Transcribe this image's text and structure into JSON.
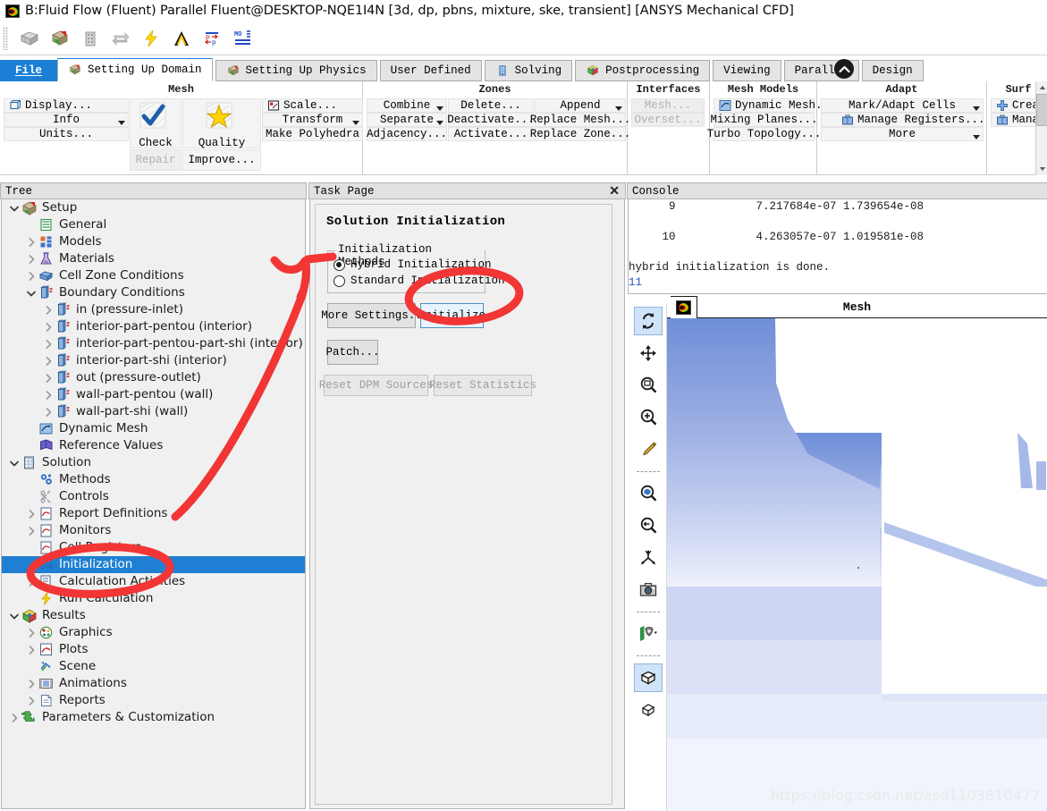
{
  "window": {
    "title": "B:Fluid Flow (Fluent) Parallel Fluent@DESKTOP-NQE1I4N  [3d, dp, pbns, mixture, ske, transient] [ANSYS Mechanical CFD]",
    "app_icon": "fluent-logo-icon"
  },
  "quick_access": [
    {
      "name": "mesh-icon",
      "label": "Mesh"
    },
    {
      "name": "setting-up-domain-icon",
      "label": "Setting Up Domain"
    },
    {
      "name": "solving-icon",
      "label": "Solving"
    },
    {
      "name": "refresh-icon",
      "label": "Refresh"
    },
    {
      "name": "run-calculation-icon",
      "label": "Run Calculation"
    },
    {
      "name": "ansys-icon",
      "label": "ANSYS"
    },
    {
      "name": "p-to-p-icon",
      "label": "Pressure"
    },
    {
      "name": "monitors-icon",
      "label": "Monitors"
    }
  ],
  "tabs": [
    {
      "label": "File",
      "icon": null,
      "state": "file"
    },
    {
      "label": "Setting Up Domain",
      "icon": "domain-icon",
      "state": "active"
    },
    {
      "label": "Setting Up Physics",
      "icon": "physics-icon",
      "state": "normal"
    },
    {
      "label": "User Defined",
      "icon": null,
      "state": "normal"
    },
    {
      "label": "Solving",
      "icon": "solving-icon",
      "state": "normal"
    },
    {
      "label": "Postprocessing",
      "icon": "post-icon",
      "state": "normal"
    },
    {
      "label": "Viewing",
      "icon": null,
      "state": "normal"
    },
    {
      "label": "Parallel",
      "icon": null,
      "state": "normal"
    },
    {
      "label": "Design",
      "icon": null,
      "state": "normal"
    }
  ],
  "ribbon": {
    "collapse_icon": "chevron-up-icon",
    "groups": [
      {
        "title": "Mesh",
        "id": "mesh",
        "col1": [
          {
            "label": "Display...",
            "icon": "display-icon",
            "disabled": false,
            "caret": false
          },
          {
            "label": "Info",
            "icon": null,
            "disabled": false,
            "caret": true
          },
          {
            "label": "Units...",
            "icon": null,
            "disabled": false,
            "caret": false
          }
        ],
        "big1": {
          "label": "Check",
          "icon": "check-icon"
        },
        "big1_sub": {
          "label": "Repair",
          "disabled": true
        },
        "big2": {
          "label": "Quality",
          "icon": "quality-star-icon"
        },
        "big2_sub": {
          "label": "Improve...",
          "disabled": false
        },
        "col4": [
          {
            "label": "Scale...",
            "icon": "scale-icon",
            "disabled": false,
            "caret": false
          },
          {
            "label": "Transform",
            "icon": null,
            "disabled": false,
            "caret": true
          },
          {
            "label": "Make Polyhedra",
            "icon": null,
            "disabled": false,
            "caret": false
          }
        ]
      },
      {
        "title": "Zones",
        "id": "zones",
        "col1": [
          {
            "label": "Combine",
            "disabled": false,
            "caret": true
          },
          {
            "label": "Separate",
            "disabled": false,
            "caret": true
          },
          {
            "label": "Adjacency...",
            "disabled": false,
            "caret": false
          }
        ],
        "col2": [
          {
            "label": "Delete...",
            "disabled": false,
            "caret": false
          },
          {
            "label": "Deactivate...",
            "disabled": false,
            "caret": false
          },
          {
            "label": "Activate...",
            "disabled": false,
            "caret": false
          }
        ],
        "col3": [
          {
            "label": "Append",
            "disabled": false,
            "caret": true
          },
          {
            "label": "Replace Mesh...",
            "disabled": false,
            "caret": false
          },
          {
            "label": "Replace Zone...",
            "disabled": false,
            "caret": false
          }
        ]
      },
      {
        "title": "Interfaces",
        "id": "interfaces",
        "col1": [
          {
            "label": "Mesh...",
            "disabled": true,
            "caret": false
          },
          {
            "label": "Overset...",
            "disabled": true,
            "caret": false
          }
        ]
      },
      {
        "title": "Mesh Models",
        "id": "mesh-models",
        "col1": [
          {
            "label": "Dynamic Mesh...",
            "icon": "dynamic-mesh-icon",
            "disabled": false,
            "caret": false
          },
          {
            "label": "Mixing Planes...",
            "icon": null,
            "disabled": false,
            "caret": false
          },
          {
            "label": "Turbo Topology...",
            "icon": null,
            "disabled": false,
            "caret": false
          }
        ]
      },
      {
        "title": "Adapt",
        "id": "adapt",
        "col1": [
          {
            "label": "Mark/Adapt Cells",
            "icon": null,
            "disabled": false,
            "caret": true
          },
          {
            "label": "Manage Registers...",
            "icon": "registers-icon",
            "disabled": false,
            "caret": false
          },
          {
            "label": "More",
            "icon": null,
            "disabled": false,
            "caret": true
          }
        ]
      },
      {
        "title": "Surf",
        "id": "surface",
        "col1": [
          {
            "label": "Create",
            "icon": "plus-icon",
            "disabled": false,
            "caret": false
          },
          {
            "label": "Manage",
            "icon": "manage-icon",
            "disabled": false,
            "caret": false
          }
        ]
      }
    ]
  },
  "tree": {
    "header": "Tree",
    "nodes": [
      {
        "label": "Setup",
        "depth": 0,
        "chev": "down",
        "icon": "setup-icon",
        "selected": false
      },
      {
        "label": "General",
        "depth": 1,
        "chev": "none",
        "icon": "general-icon",
        "selected": false
      },
      {
        "label": "Models",
        "depth": 1,
        "chev": "right",
        "icon": "models-icon",
        "selected": false
      },
      {
        "label": "Materials",
        "depth": 1,
        "chev": "right",
        "icon": "materials-icon",
        "selected": false
      },
      {
        "label": "Cell Zone Conditions",
        "depth": 1,
        "chev": "right",
        "icon": "cellzone-icon",
        "selected": false
      },
      {
        "label": "Boundary Conditions",
        "depth": 1,
        "chev": "down",
        "icon": "boundary-icon",
        "selected": false
      },
      {
        "label": "in (pressure-inlet)",
        "depth": 2,
        "chev": "right",
        "icon": "boundary-icon",
        "selected": false
      },
      {
        "label": "interior-part-pentou (interior)",
        "depth": 2,
        "chev": "right",
        "icon": "boundary-icon",
        "selected": false
      },
      {
        "label": "interior-part-pentou-part-shi (interior)",
        "depth": 2,
        "chev": "right",
        "icon": "boundary-icon",
        "selected": false
      },
      {
        "label": "interior-part-shi (interior)",
        "depth": 2,
        "chev": "right",
        "icon": "boundary-icon",
        "selected": false
      },
      {
        "label": "out (pressure-outlet)",
        "depth": 2,
        "chev": "right",
        "icon": "boundary-icon",
        "selected": false
      },
      {
        "label": "wall-part-pentou (wall)",
        "depth": 2,
        "chev": "right",
        "icon": "boundary-icon",
        "selected": false
      },
      {
        "label": "wall-part-shi (wall)",
        "depth": 2,
        "chev": "right",
        "icon": "boundary-icon",
        "selected": false
      },
      {
        "label": "Dynamic Mesh",
        "depth": 1,
        "chev": "none",
        "icon": "dynamic-mesh-icon",
        "selected": false
      },
      {
        "label": "Reference Values",
        "depth": 1,
        "chev": "none",
        "icon": "reference-values-icon",
        "selected": false
      },
      {
        "label": "Solution",
        "depth": 0,
        "chev": "down",
        "icon": "solution-icon",
        "selected": false
      },
      {
        "label": "Methods",
        "depth": 1,
        "chev": "none",
        "icon": "methods-icon",
        "selected": false
      },
      {
        "label": "Controls",
        "depth": 1,
        "chev": "none",
        "icon": "controls-icon",
        "selected": false
      },
      {
        "label": "Report Definitions",
        "depth": 1,
        "chev": "right",
        "icon": "report-icon",
        "selected": false
      },
      {
        "label": "Monitors",
        "depth": 1,
        "chev": "right",
        "icon": "report-icon",
        "selected": false
      },
      {
        "label": "Cell Registers",
        "depth": 1,
        "chev": "none",
        "icon": "report-icon",
        "selected": false
      },
      {
        "label": "Initialization",
        "depth": 1,
        "chev": "none",
        "icon": "initialization-icon",
        "selected": true
      },
      {
        "label": "Calculation Activities",
        "depth": 1,
        "chev": "right",
        "icon": "calc-activities-icon",
        "selected": false
      },
      {
        "label": "Run Calculation",
        "depth": 1,
        "chev": "none",
        "icon": "run-calculation-icon",
        "selected": false
      },
      {
        "label": "Results",
        "depth": 0,
        "chev": "down",
        "icon": "results-icon",
        "selected": false
      },
      {
        "label": "Graphics",
        "depth": 1,
        "chev": "right",
        "icon": "graphics-icon",
        "selected": false
      },
      {
        "label": "Plots",
        "depth": 1,
        "chev": "right",
        "icon": "plots-icon",
        "selected": false
      },
      {
        "label": "Scene",
        "depth": 1,
        "chev": "none",
        "icon": "scene-icon",
        "selected": false
      },
      {
        "label": "Animations",
        "depth": 1,
        "chev": "right",
        "icon": "animations-icon",
        "selected": false
      },
      {
        "label": "Reports",
        "depth": 1,
        "chev": "right",
        "icon": "reports-icon",
        "selected": false
      },
      {
        "label": "Parameters & Customization",
        "depth": 0,
        "chev": "right",
        "icon": "parameters-icon",
        "selected": false
      }
    ]
  },
  "task_page": {
    "header": "Task Page",
    "close_label": "✕",
    "title": "Solution Initialization",
    "groupbox_legend": "Initialization Methods",
    "methods": [
      {
        "label": "Hybrid  Initialization",
        "selected": true
      },
      {
        "label": "Standard Initialization",
        "selected": false
      }
    ],
    "buttons": {
      "more_settings": "More Settings..",
      "initialize": "Initialize",
      "patch": "Patch...",
      "reset_dpm": "Reset DPM Sources",
      "reset_stats": "Reset Statistics"
    }
  },
  "console": {
    "header": "Console",
    "lines": [
      {
        "text": "      9            7.217684e-07 1.739654e-08",
        "style": "normal"
      },
      {
        "text": "",
        "style": "normal"
      },
      {
        "text": "     10            4.263057e-07 1.019581e-08",
        "style": "normal"
      },
      {
        "text": "",
        "style": "normal"
      },
      {
        "text": "hybrid initialization is done.",
        "style": "normal"
      },
      {
        "text": "11",
        "style": "blue"
      }
    ]
  },
  "graphics": {
    "tab_title": "Mesh",
    "tab_icon": "fluent-logo-icon",
    "watermark": "https://blog.csdn.net/asd1103810477",
    "toolbar": [
      {
        "name": "rotate-view-icon",
        "active": true,
        "sep_after": false
      },
      {
        "name": "pan-view-icon",
        "active": false,
        "sep_after": false
      },
      {
        "name": "zoom-box-icon",
        "active": false,
        "sep_after": false
      },
      {
        "name": "zoom-in-icon",
        "active": false,
        "sep_after": false
      },
      {
        "name": "probe-picker-icon",
        "active": false,
        "sep_after": true
      },
      {
        "name": "fit-to-window-icon",
        "active": false,
        "sep_after": false
      },
      {
        "name": "zoom-out-icon",
        "active": false,
        "sep_after": false
      },
      {
        "name": "axis-view-icon",
        "active": false,
        "sep_after": false
      },
      {
        "name": "camera-snapshot-icon",
        "active": false,
        "sep_after": true
      },
      {
        "name": "lighting-icon",
        "active": false,
        "sep_after": true
      },
      {
        "name": "perspective-box-icon",
        "active": true,
        "sep_after": false
      },
      {
        "name": "orthographic-box-icon",
        "active": false,
        "sep_after": false
      }
    ]
  },
  "colors": {
    "accent_blue": "#1f7fd2",
    "annotation_red": "#f23535",
    "mesh_blue_top": "#6f8fd8",
    "mesh_blue_bottom": "#f2f5fc",
    "titlebar_bg": "#ffffff"
  },
  "annotations": {
    "arrow_label": "arrow-from-initialization-to-initialize",
    "circle_initialize_label": "circle-around-initialize-button",
    "circle_tree_label": "circle-around-initialization-tree-item"
  }
}
